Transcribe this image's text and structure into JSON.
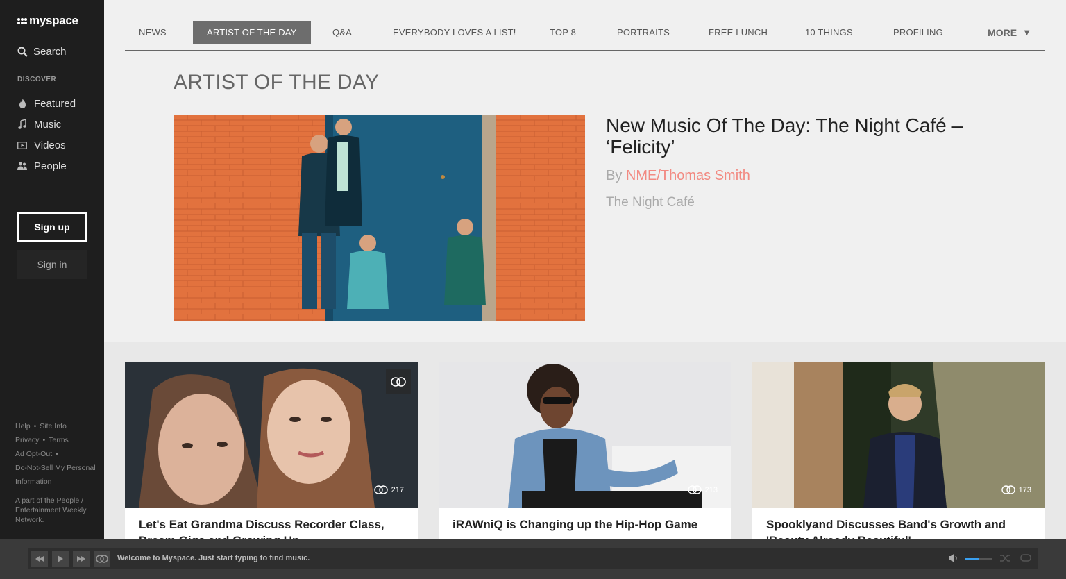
{
  "sidebar": {
    "logo_text": "myspace",
    "search_label": "Search",
    "discover_label": "DISCOVER",
    "items": [
      {
        "label": "Featured",
        "icon": "flame-icon"
      },
      {
        "label": "Music",
        "icon": "music-note-icon"
      },
      {
        "label": "Videos",
        "icon": "video-icon"
      },
      {
        "label": "People",
        "icon": "people-icon"
      }
    ],
    "signup_label": "Sign up",
    "signin_label": "Sign in",
    "footer": {
      "help": "Help",
      "site_info": "Site Info",
      "privacy": "Privacy",
      "terms": "Terms",
      "ad_opt_out": "Ad Opt-Out",
      "do_not_sell": "Do-Not-Sell My Personal Information",
      "network": "A part of the People / Entertainment Weekly Network."
    }
  },
  "topnav": {
    "tabs": [
      {
        "label": "NEWS"
      },
      {
        "label": "ARTIST OF THE DAY",
        "active": true
      },
      {
        "label": "Q&A"
      },
      {
        "label": "EVERYBODY LOVES A LIST!"
      },
      {
        "label": "TOP 8"
      },
      {
        "label": "PORTRAITS"
      },
      {
        "label": "FREE LUNCH"
      },
      {
        "label": "10 THINGS"
      },
      {
        "label": "PROFILING"
      }
    ],
    "more_label": "MORE"
  },
  "feature": {
    "section_title": "ARTIST OF THE DAY",
    "title": "New Music Of The Day: The Night Café – ‘Felicity’",
    "by_prefix": "By",
    "author": "NME/Thomas Smith",
    "artist": "The Night Café"
  },
  "cards": [
    {
      "title": "Let's Eat Grandma Discuss Recorder Class, Dream Gigs and Growing Up",
      "count": "217"
    },
    {
      "title": "iRAWniQ is Changing up the Hip-Hop Game",
      "count": "213"
    },
    {
      "title": "Spooklyand Discusses Band's Growth and 'Beauty Already Beautiful'",
      "count": "173"
    }
  ],
  "player": {
    "message": "Welcome to Myspace. Just start typing to find music.",
    "volume_level": 0.5
  },
  "colors": {
    "sidebar_bg": "#1e1e1e",
    "accent_author": "#f28a82",
    "volume_accent": "#3aa0f0"
  }
}
